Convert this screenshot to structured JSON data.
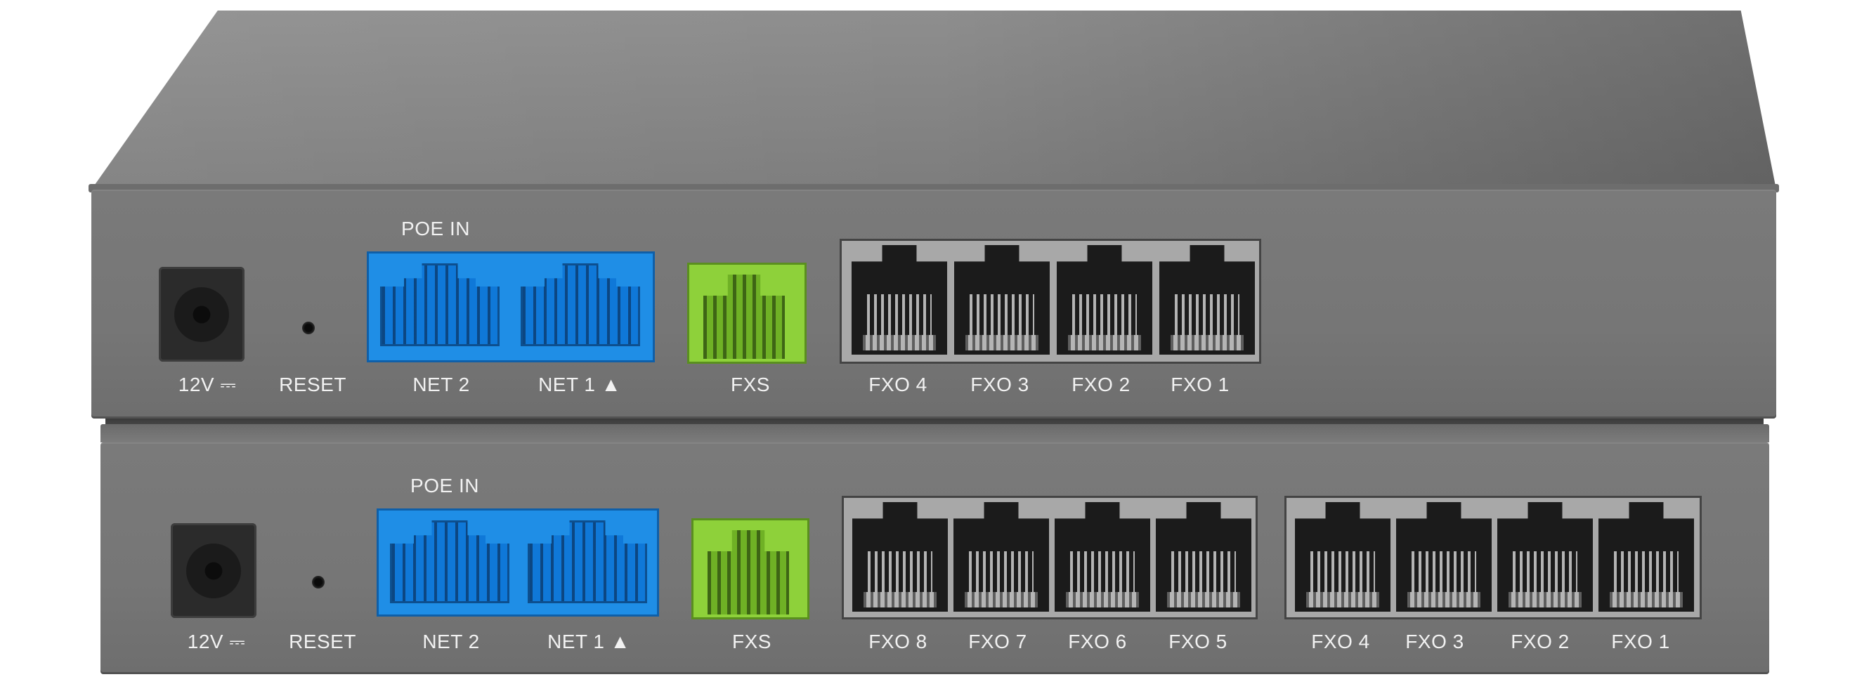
{
  "top_unit": {
    "power_label": "12V ⎓",
    "reset_label": "RESET",
    "poe_label": "POE IN",
    "lan_ports": [
      {
        "label": "NET 2"
      },
      {
        "label": "NET 1 ▲"
      }
    ],
    "fxs_label": "FXS",
    "fxo_ports": [
      {
        "label": "FXO 4"
      },
      {
        "label": "FXO 3"
      },
      {
        "label": "FXO 2"
      },
      {
        "label": "FXO 1"
      }
    ]
  },
  "bottom_unit": {
    "power_label": "12V ⎓",
    "reset_label": "RESET",
    "poe_label": "POE IN",
    "lan_ports": [
      {
        "label": "NET 2"
      },
      {
        "label": "NET 1 ▲"
      }
    ],
    "fxs_label": "FXS",
    "fxo_ports": [
      {
        "label": "FXO 8"
      },
      {
        "label": "FXO 7"
      },
      {
        "label": "FXO 6"
      },
      {
        "label": "FXO 5"
      },
      {
        "label": "FXO 4"
      },
      {
        "label": "FXO 3"
      },
      {
        "label": "FXO 2"
      },
      {
        "label": "FXO 1"
      }
    ]
  },
  "colors": {
    "chassis": "#7a7a7a",
    "lan_port": "#1f8ee6",
    "fxs_port": "#8ed13a",
    "fxo_port": "#1b1b1b",
    "label_text": "#f2f2f2"
  }
}
